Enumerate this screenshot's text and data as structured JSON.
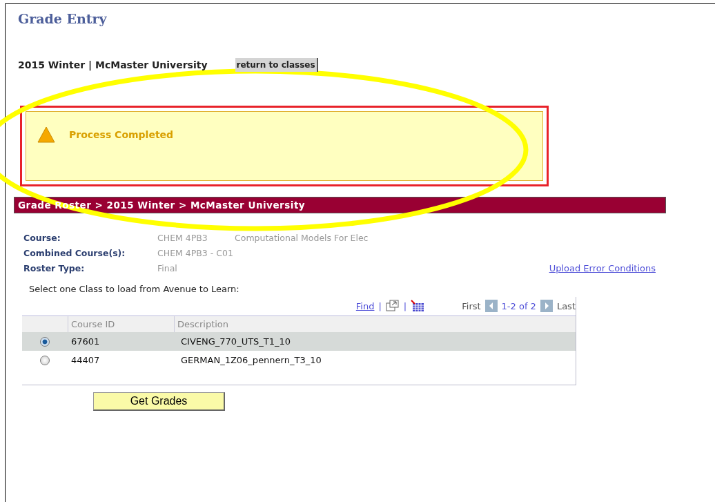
{
  "title": "Grade Entry",
  "term": "2015 Winter | McMaster University",
  "return_button": "return to classes",
  "message": {
    "kind": "warning",
    "text": "Process Completed"
  },
  "breadcrumb": "Grade Roster > 2015 Winter > McMaster University",
  "fields": [
    {
      "label": "Course:",
      "value": "CHEM 4PB3",
      "extra": "Computational Models For Elec"
    },
    {
      "label": "Combined Course(s):",
      "value": "CHEM 4PB3 - C01"
    },
    {
      "label": "Roster Type:",
      "value": "Final"
    }
  ],
  "upload_link": "Upload Error Conditions",
  "instruction": "Select one Class to load from Avenue to Learn:",
  "grid": {
    "find": "Find",
    "separators": [
      "|",
      "|"
    ],
    "first": "First",
    "range": "1-2 of 2",
    "last": "Last",
    "columns": [
      "Course ID",
      "Description"
    ],
    "rows": [
      {
        "course_id": "67601",
        "description": "CIVENG_770_UTS_T1_10",
        "selected": true
      },
      {
        "course_id": "44407",
        "description": "GERMAN_1Z06_pennern_T3_10",
        "selected": false
      }
    ]
  },
  "get_button": "Get Grades"
}
